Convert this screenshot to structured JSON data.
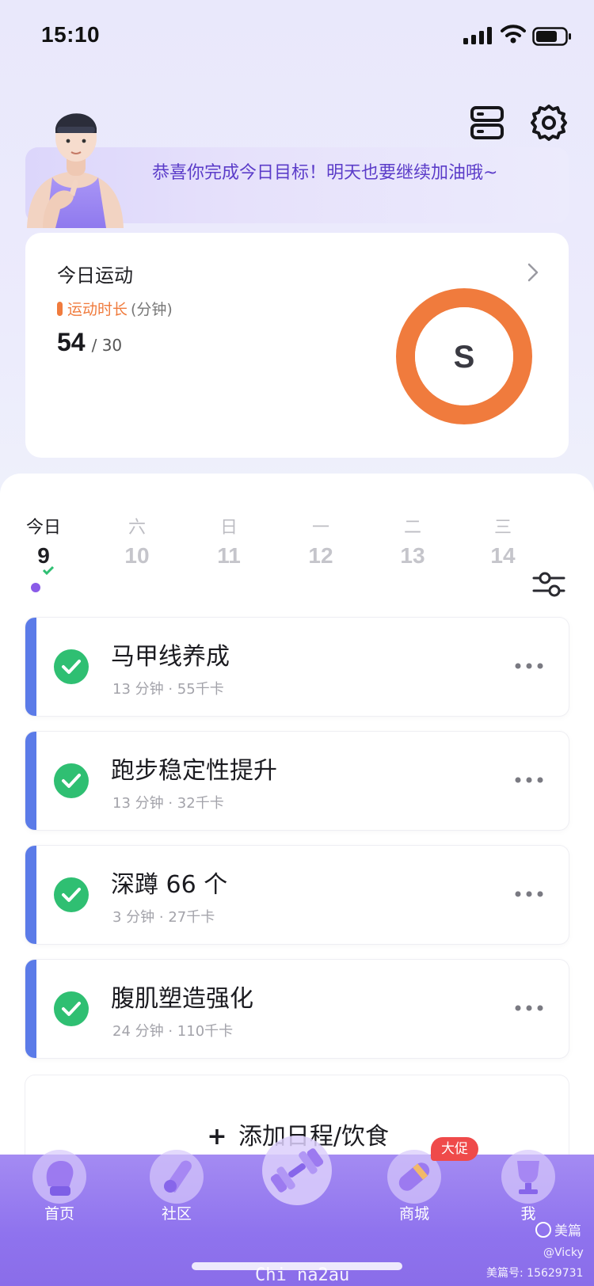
{
  "status_bar": {
    "time": "15:10"
  },
  "banner": {
    "message": "恭喜你完成今日目标！明天也要继续加油哦~"
  },
  "today_card": {
    "title": "今日运动",
    "metric_label": "运动时长",
    "metric_unit": "(分钟)",
    "value": "54",
    "goal": "/ 30",
    "ring_letter": "S",
    "ring_color": "#f07b3d"
  },
  "calendar": {
    "days": [
      {
        "weekday": "今日",
        "date": "9",
        "active": true
      },
      {
        "weekday": "六",
        "date": "10"
      },
      {
        "weekday": "日",
        "date": "11"
      },
      {
        "weekday": "一",
        "date": "12"
      },
      {
        "weekday": "二",
        "date": "13"
      },
      {
        "weekday": "三",
        "date": "14"
      }
    ]
  },
  "tasks": [
    {
      "name": "马甲线养成",
      "meta": "13 分钟 · 55千卡"
    },
    {
      "name": "跑步稳定性提升",
      "meta": "13 分钟 · 32千卡"
    },
    {
      "name": "深蹲 66 个",
      "meta": "3 分钟 · 27千卡"
    },
    {
      "name": "腹肌塑造强化",
      "meta": "24 分钟 · 110千卡"
    }
  ],
  "add_button": {
    "label": "添加日程/饮食"
  },
  "tabbar": {
    "tabs": [
      {
        "label": "首页"
      },
      {
        "label": "社区"
      },
      {
        "label": ""
      },
      {
        "label": "商城"
      },
      {
        "label": "我"
      }
    ],
    "promo_badge": "大促"
  },
  "watermark": {
    "brand": "美篇",
    "user": "@Vicky",
    "account": "美篇号: 15629731",
    "source": "Chi na2au"
  },
  "colors": {
    "accent": "#5b7be8",
    "success": "#2fbf72",
    "tabbar": "#8f73ee",
    "promo": "#ef4a4a"
  }
}
